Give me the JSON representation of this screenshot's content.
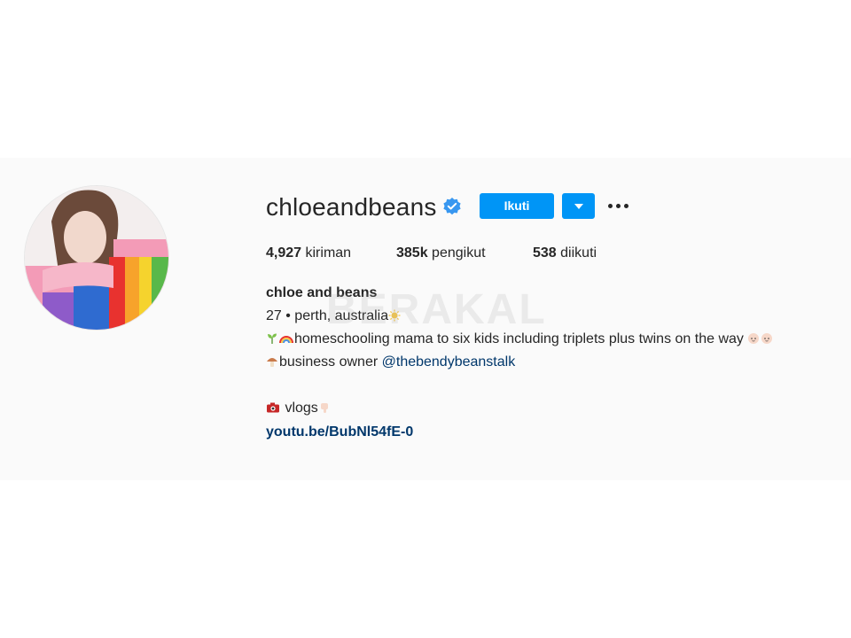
{
  "profile": {
    "username": "chloeandbeans",
    "verified": true,
    "follow_label": "Ikuti",
    "stats": {
      "posts_value": "4,927",
      "posts_label": "kiriman",
      "followers_value": "385k",
      "followers_label": "pengikut",
      "following_value": "538",
      "following_label": "diikuti"
    },
    "full_name": "chloe and beans",
    "bio": {
      "line1": "27 • perth, australia",
      "line2": "homeschooling mama to six kids including triplets plus twins on the way",
      "line3_text": "business owner",
      "line3_mention": "@thebendybeanstalk",
      "line4": "vlogs",
      "link": "youtu.be/BubNl54fE-0"
    }
  },
  "watermark": "BERAKAL",
  "colors": {
    "accent": "#0095f6",
    "verified": "#3897f0",
    "link": "#00376b",
    "text": "#262626",
    "background": "#fafafa"
  },
  "icons": {
    "verified": "verified-badge-icon",
    "dropdown": "chevron-down-icon",
    "more": "more-options-icon",
    "sun": "sun-emoji",
    "seedling": "seedling-emoji",
    "rainbow": "rainbow-emoji",
    "baby": "baby-emoji",
    "mushroom": "mushroom-emoji",
    "camera": "camera-emoji",
    "pointing": "pointing-down-emoji"
  }
}
